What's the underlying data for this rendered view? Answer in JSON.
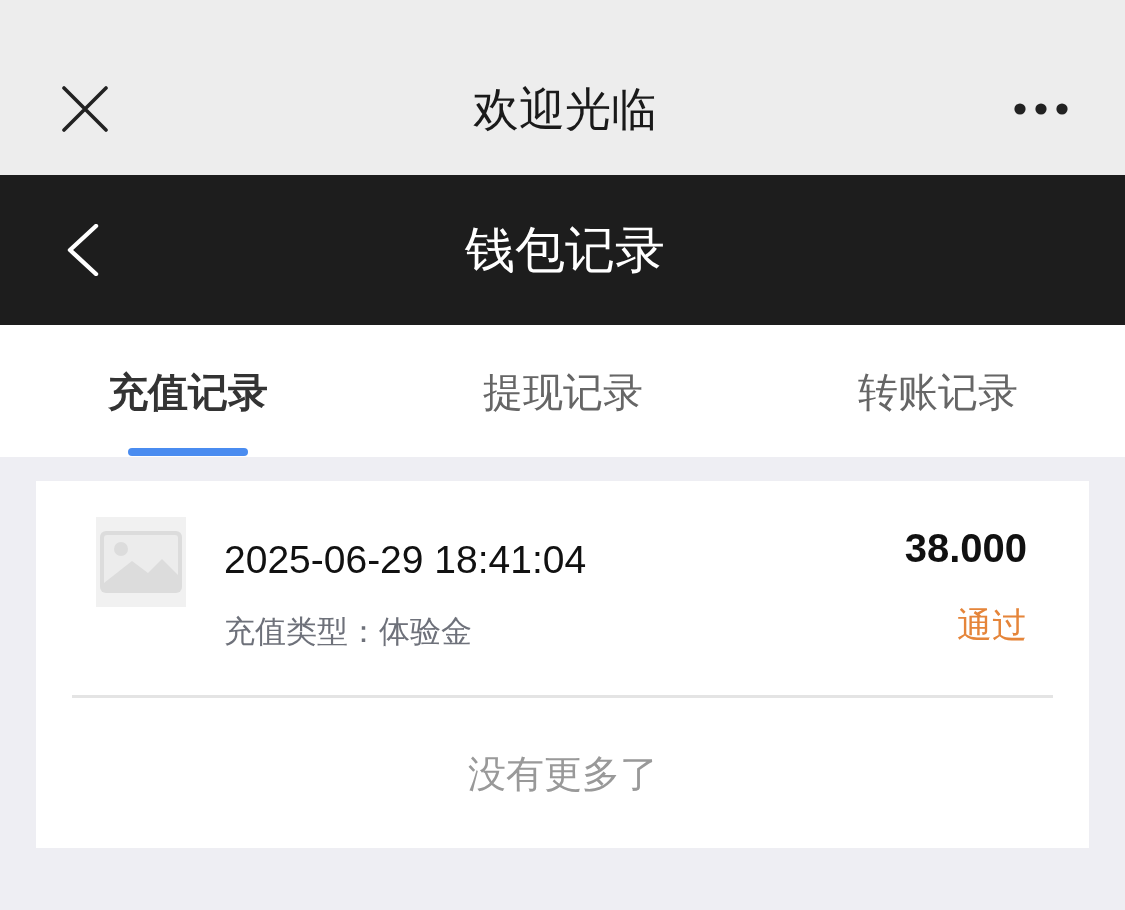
{
  "top_bar": {
    "title": "欢迎光临"
  },
  "header": {
    "title": "钱包记录"
  },
  "tabs": [
    {
      "label": "充值记录",
      "selected": true
    },
    {
      "label": "提现记录",
      "selected": false
    },
    {
      "label": "转账记录",
      "selected": false
    }
  ],
  "records": [
    {
      "time": "2025-06-29 18:41:04",
      "type": "充值类型：体验金",
      "amount": "38.000",
      "status": {
        "label": "通过",
        "color": "#e5853a"
      }
    }
  ],
  "end_note": "没有更多了"
}
